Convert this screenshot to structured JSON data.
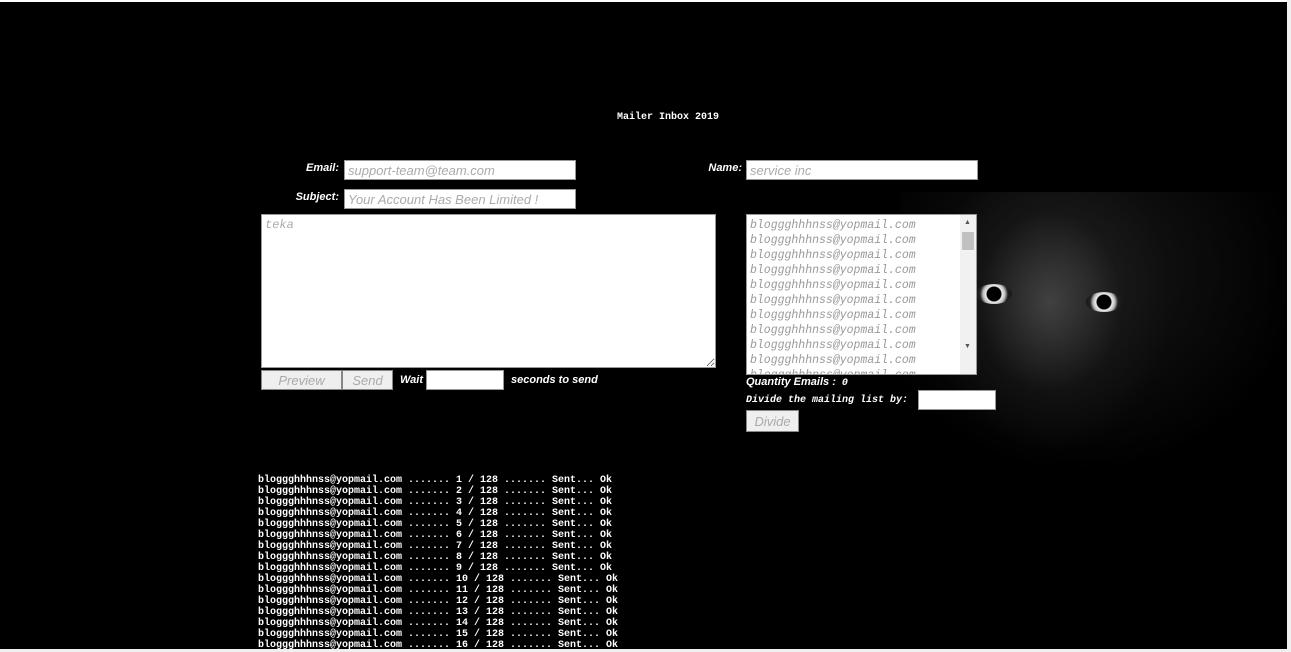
{
  "title": "Mailer Inbox 2019",
  "form": {
    "email_label": "Email:",
    "email_placeholder": "support-team@team.com",
    "name_label": "Name:",
    "name_placeholder": "service inc",
    "subject_label": "Subject:",
    "subject_placeholder": "Your Account Has Been Limited !",
    "message_placeholder": "teka"
  },
  "actions": {
    "preview_label": "Preview",
    "send_label": "Send",
    "wait_label": "Wait",
    "seconds_label": "seconds to send"
  },
  "mailing_list": {
    "emails": [
      "bloggghhhnss@yopmail.com",
      "bloggghhhnss@yopmail.com",
      "bloggghhhnss@yopmail.com",
      "bloggghhhnss@yopmail.com",
      "bloggghhhnss@yopmail.com",
      "bloggghhhnss@yopmail.com",
      "bloggghhhnss@yopmail.com",
      "bloggghhhnss@yopmail.com",
      "bloggghhhnss@yopmail.com",
      "bloggghhhnss@yopmail.com",
      "bloggghhhnss@yopmail.com"
    ],
    "quantity_label": "Quantity Emails :",
    "quantity_value": "0",
    "divide_label": "Divide the mailing list by:",
    "divide_button": "Divide"
  },
  "log": [
    "bloggghhhnss@yopmail.com ....... 1 / 128 ....... Sent... Ok",
    "bloggghhhnss@yopmail.com ....... 2 / 128 ....... Sent... Ok",
    "bloggghhhnss@yopmail.com ....... 3 / 128 ....... Sent... Ok",
    "bloggghhhnss@yopmail.com ....... 4 / 128 ....... Sent... Ok",
    "bloggghhhnss@yopmail.com ....... 5 / 128 ....... Sent... Ok",
    "bloggghhhnss@yopmail.com ....... 6 / 128 ....... Sent... Ok",
    "bloggghhhnss@yopmail.com ....... 7 / 128 ....... Sent... Ok",
    "bloggghhhnss@yopmail.com ....... 8 / 128 ....... Sent... Ok",
    "bloggghhhnss@yopmail.com ....... 9 / 128 ....... Sent... Ok",
    "bloggghhhnss@yopmail.com ....... 10 / 128 ....... Sent... Ok",
    "bloggghhhnss@yopmail.com ....... 11 / 128 ....... Sent... Ok",
    "bloggghhhnss@yopmail.com ....... 12 / 128 ....... Sent... Ok",
    "bloggghhhnss@yopmail.com ....... 13 / 128 ....... Sent... Ok",
    "bloggghhhnss@yopmail.com ....... 14 / 128 ....... Sent... Ok",
    "bloggghhhnss@yopmail.com ....... 15 / 128 ....... Sent... Ok",
    "bloggghhhnss@yopmail.com ....... 16 / 128 ....... Sent... Ok"
  ]
}
